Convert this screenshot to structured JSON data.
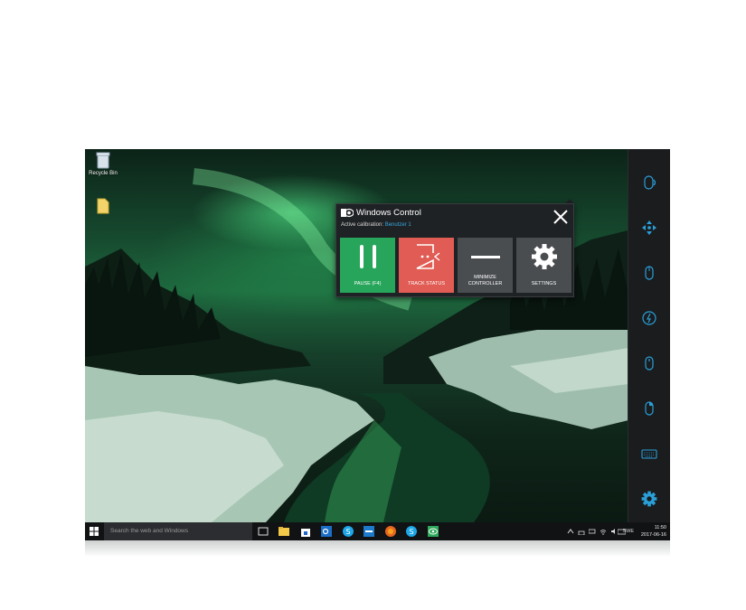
{
  "desktop": {
    "recycle_bin_label": "Recycle Bin",
    "folder_label": ""
  },
  "controller": {
    "title": "Windows Control",
    "calibration_label": "Active calibration:",
    "calibration_user": "Benutzer 1",
    "tiles": {
      "pause": "PAUSE (F4)",
      "track_status": "TRACK STATUS",
      "minimize_line1": "MINIMIZE",
      "minimize_line2": "CONTROLLER",
      "settings": "SETTINGS"
    },
    "colors": {
      "pause": "#27a55a",
      "track_status": "#e05c54",
      "neutral": "#4a4d50",
      "accent": "#35a8e0"
    }
  },
  "sidebar": {
    "items": [
      "mouse-double-click-icon",
      "move-icon",
      "mouse-left-click-icon",
      "scroll-icon",
      "mouse-click-icon",
      "mouse-right-click-icon",
      "keyboard-icon",
      "gear-icon"
    ]
  },
  "taskbar": {
    "search_placeholder": "Search the web and Windows",
    "language": "SWE",
    "time": "11:50",
    "date": "2017-06-16",
    "apps": [
      "task-view-icon",
      "file-explorer-icon",
      "store-icon",
      "outlook-icon",
      "skype-icon",
      "app-icon",
      "firefox-icon",
      "skype-icon",
      "eye-tracker-icon"
    ]
  }
}
